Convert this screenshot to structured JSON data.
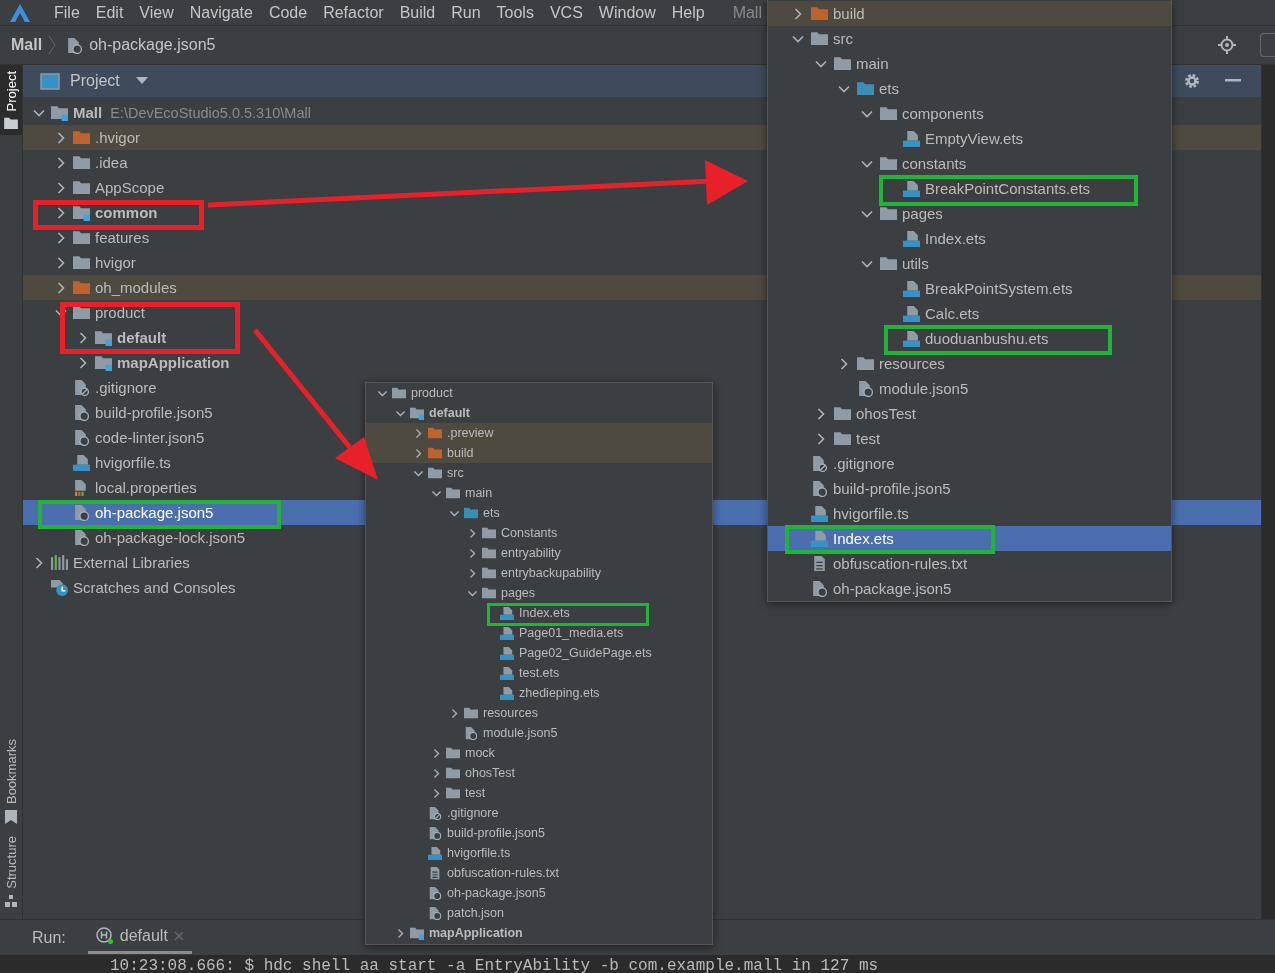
{
  "menu_bar": {
    "items": [
      "File",
      "Edit",
      "View",
      "Navigate",
      "Code",
      "Refactor",
      "Build",
      "Run",
      "Tools",
      "VCS",
      "Window",
      "Help"
    ],
    "title": "Mall"
  },
  "breadcrumb": {
    "project": "Mall",
    "file": "oh-package.json5"
  },
  "side_tabs_top": [
    {
      "label": "Project",
      "selected": true
    }
  ],
  "side_tabs_bottom": [
    {
      "label": "Bookmarks",
      "selected": false
    },
    {
      "label": "Structure",
      "selected": false
    }
  ],
  "project_panel": {
    "title": "Project",
    "tree": [
      {
        "name": "Mall",
        "kind": "project",
        "path": "E:\\DevEcoStudio5.0.5.310\\Mall",
        "expanded": true,
        "selected": false,
        "children": [
          {
            "name": ".hvigor",
            "kind": "folder-excluded",
            "expanded": false,
            "selected": false
          },
          {
            "name": ".idea",
            "kind": "folder",
            "expanded": false,
            "selected": false
          },
          {
            "name": "AppScope",
            "kind": "folder",
            "expanded": false,
            "selected": false
          },
          {
            "name": "common",
            "kind": "folder-module",
            "expanded": false,
            "selected": false
          },
          {
            "name": "features",
            "kind": "folder",
            "expanded": false,
            "selected": false
          },
          {
            "name": "hvigor",
            "kind": "folder",
            "expanded": false,
            "selected": false
          },
          {
            "name": "oh_modules",
            "kind": "folder-excluded",
            "expanded": false,
            "selected": false
          },
          {
            "name": "product",
            "kind": "folder",
            "expanded": true,
            "selected": false,
            "children": [
              {
                "name": "default",
                "kind": "folder-module",
                "expanded": false,
                "selected": false
              },
              {
                "name": "mapApplication",
                "kind": "folder-module",
                "expanded": false,
                "selected": false
              }
            ]
          },
          {
            "name": ".gitignore",
            "kind": "file-ignore",
            "selected": false
          },
          {
            "name": "build-profile.json5",
            "kind": "file-json",
            "selected": false
          },
          {
            "name": "code-linter.json5",
            "kind": "file-json",
            "selected": false
          },
          {
            "name": "hvigorfile.ts",
            "kind": "file-ts",
            "selected": false
          },
          {
            "name": "local.properties",
            "kind": "file-properties",
            "selected": false
          },
          {
            "name": "oh-package.json5",
            "kind": "file-json",
            "selected": true
          },
          {
            "name": "oh-package-lock.json5",
            "kind": "file-json",
            "selected": false
          }
        ]
      },
      {
        "name": "External Libraries",
        "kind": "libraries",
        "expanded": false,
        "selected": false
      },
      {
        "name": "Scratches and Consoles",
        "kind": "scratches",
        "selected": false
      }
    ]
  },
  "popups": [
    {
      "tree": [
        {
          "name": "product",
          "kind": "folder",
          "expanded": true,
          "selected": false,
          "children": [
            {
              "name": "default",
              "kind": "folder-module",
              "expanded": true,
              "selected": false,
              "children": [
                {
                  "name": ".preview",
                  "kind": "folder-excluded",
                  "expanded": false,
                  "selected": false
                },
                {
                  "name": "build",
                  "kind": "folder-excluded",
                  "expanded": false,
                  "selected": false
                },
                {
                  "name": "src",
                  "kind": "folder",
                  "expanded": true,
                  "selected": false,
                  "children": [
                    {
                      "name": "main",
                      "kind": "folder",
                      "expanded": true,
                      "selected": false,
                      "children": [
                        {
                          "name": "ets",
                          "kind": "folder-source",
                          "expanded": true,
                          "selected": false,
                          "children": [
                            {
                              "name": "Constants",
                              "kind": "folder",
                              "expanded": false,
                              "selected": false
                            },
                            {
                              "name": "entryability",
                              "kind": "folder",
                              "expanded": false,
                              "selected": false
                            },
                            {
                              "name": "entrybackupability",
                              "kind": "folder",
                              "expanded": false,
                              "selected": false
                            },
                            {
                              "name": "pages",
                              "kind": "folder",
                              "expanded": true,
                              "selected": false,
                              "children": [
                                {
                                  "name": "Index.ets",
                                  "kind": "file-ets",
                                  "selected": false
                                },
                                {
                                  "name": "Page01_media.ets",
                                  "kind": "file-ets",
                                  "selected": false
                                },
                                {
                                  "name": "Page02_GuidePage.ets",
                                  "kind": "file-ets",
                                  "selected": false
                                },
                                {
                                  "name": "test.ets",
                                  "kind": "file-ets",
                                  "selected": false
                                },
                                {
                                  "name": "zhedieping.ets",
                                  "kind": "file-ets",
                                  "selected": false
                                }
                              ]
                            }
                          ]
                        },
                        {
                          "name": "resources",
                          "kind": "folder",
                          "expanded": false,
                          "selected": false
                        },
                        {
                          "name": "module.json5",
                          "kind": "file-json",
                          "selected": false
                        }
                      ]
                    },
                    {
                      "name": "mock",
                      "kind": "folder",
                      "expanded": false,
                      "selected": false
                    },
                    {
                      "name": "ohosTest",
                      "kind": "folder",
                      "expanded": false,
                      "selected": false
                    },
                    {
                      "name": "test",
                      "kind": "folder",
                      "expanded": false,
                      "selected": false
                    }
                  ]
                },
                {
                  "name": ".gitignore",
                  "kind": "file-ignore",
                  "selected": false
                },
                {
                  "name": "build-profile.json5",
                  "kind": "file-json",
                  "selected": false
                },
                {
                  "name": "hvigorfile.ts",
                  "kind": "file-ts",
                  "selected": false
                },
                {
                  "name": "obfuscation-rules.txt",
                  "kind": "file-text",
                  "selected": false
                },
                {
                  "name": "oh-package.json5",
                  "kind": "file-json",
                  "selected": false
                },
                {
                  "name": "patch.json",
                  "kind": "file-json",
                  "selected": false
                }
              ]
            },
            {
              "name": "mapApplication",
              "kind": "folder-module",
              "expanded": false,
              "selected": false
            }
          ]
        }
      ]
    },
    {
      "tree": [
        {
          "name": "build",
          "kind": "folder-excluded",
          "expanded": false,
          "selected": false
        },
        {
          "name": "src",
          "kind": "folder",
          "expanded": true,
          "selected": false,
          "children": [
            {
              "name": "main",
              "kind": "folder",
              "expanded": true,
              "selected": false,
              "children": [
                {
                  "name": "ets",
                  "kind": "folder-source",
                  "expanded": true,
                  "selected": false,
                  "children": [
                    {
                      "name": "components",
                      "kind": "folder",
                      "expanded": true,
                      "selected": false,
                      "children": [
                        {
                          "name": "EmptyView.ets",
                          "kind": "file-ets",
                          "selected": false
                        }
                      ]
                    },
                    {
                      "name": "constants",
                      "kind": "folder",
                      "expanded": true,
                      "selected": false,
                      "children": [
                        {
                          "name": "BreakPointConstants.ets",
                          "kind": "file-ets",
                          "selected": false
                        }
                      ]
                    },
                    {
                      "name": "pages",
                      "kind": "folder",
                      "expanded": true,
                      "selected": false,
                      "children": [
                        {
                          "name": "Index.ets",
                          "kind": "file-ets",
                          "selected": false
                        }
                      ]
                    },
                    {
                      "name": "utils",
                      "kind": "folder",
                      "expanded": true,
                      "selected": false,
                      "children": [
                        {
                          "name": "BreakPointSystem.ets",
                          "kind": "file-ets",
                          "selected": false
                        },
                        {
                          "name": "Calc.ets",
                          "kind": "file-ets",
                          "selected": false
                        },
                        {
                          "name": "duoduanbushu.ets",
                          "kind": "file-ets",
                          "selected": false
                        }
                      ]
                    }
                  ]
                },
                {
                  "name": "resources",
                  "kind": "folder",
                  "expanded": false,
                  "selected": false
                },
                {
                  "name": "module.json5",
                  "kind": "file-json",
                  "selected": false
                }
              ]
            },
            {
              "name": "ohosTest",
              "kind": "folder",
              "expanded": false,
              "selected": false
            },
            {
              "name": "test",
              "kind": "folder",
              "expanded": false,
              "selected": false
            }
          ]
        },
        {
          "name": ".gitignore",
          "kind": "file-ignore",
          "selected": false
        },
        {
          "name": "build-profile.json5",
          "kind": "file-json",
          "selected": false
        },
        {
          "name": "hvigorfile.ts",
          "kind": "file-ts",
          "selected": false
        },
        {
          "name": "Index.ets",
          "kind": "file-ets",
          "selected": true
        },
        {
          "name": "obfuscation-rules.txt",
          "kind": "file-text",
          "selected": false
        },
        {
          "name": "oh-package.json5",
          "kind": "file-json",
          "selected": false
        }
      ]
    }
  ],
  "run_bar": {
    "label": "Run:",
    "tab": "default",
    "console_line": "10:23:08.666: $ hdc shell aa start -a EntryAbility -b com.example.mall in 127 ms"
  }
}
